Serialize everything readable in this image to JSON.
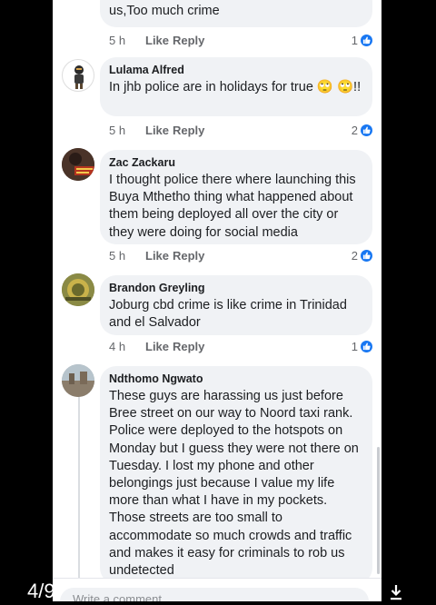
{
  "page_indicator": "4/9",
  "comments": [
    {
      "author": "",
      "text": "us,Too much crime",
      "time": "5 h",
      "like": "Like",
      "reply": "Reply",
      "reactions": "1"
    },
    {
      "author": "Lulama Alfred",
      "text": "In jhb police are in holidays for true 🙄 🙄!!",
      "time": "5 h",
      "like": "Like",
      "reply": "Reply",
      "reactions": "2"
    },
    {
      "author": "Zac Zackaru",
      "text": "I thought police there where launching this Buya Mthetho thing what happened about them being deployed all over the city or they were doing for social media",
      "time": "5 h",
      "like": "Like",
      "reply": "Reply",
      "reactions": "2"
    },
    {
      "author": "Brandon Greyling",
      "text": "Joburg cbd crime is like crime in Trinidad and el Salvador",
      "time": "4 h",
      "like": "Like",
      "reply": "Reply",
      "reactions": "1"
    },
    {
      "author": "Ndthomo Ngwato",
      "text": "These guys are harassing us just before Bree street on our way to Noord taxi rank. Police were deployed to the hotspots on Monday but I guess they were not there on Tuesday. I lost my phone and other belongings just because I value my life more than what I have in my pockets. Those streets are too small to accommodate so much crowds and traffic and makes it easy for criminals to rob us undetected"
    }
  ],
  "input": {
    "placeholder": "Write a comment..."
  },
  "colors": {
    "accent": "#1877f2",
    "bubble": "#f0f2f5"
  }
}
